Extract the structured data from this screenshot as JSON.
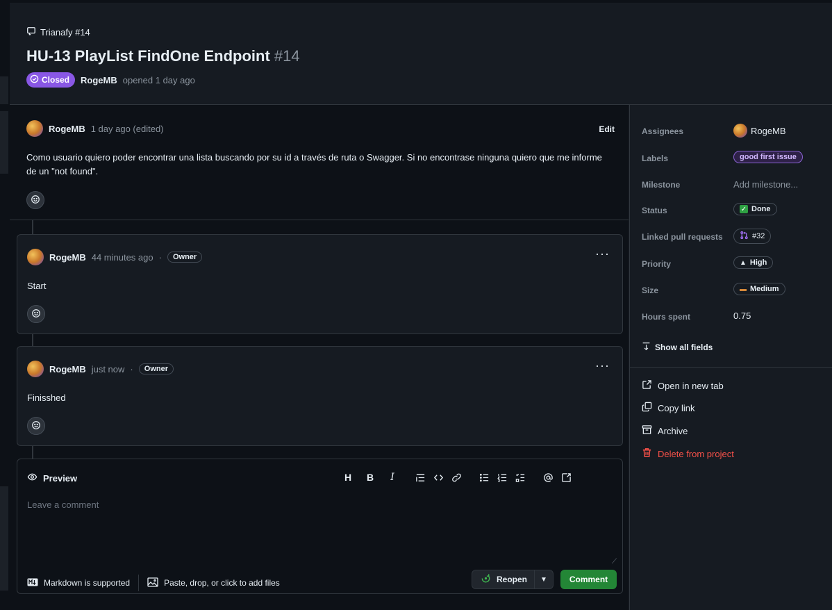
{
  "header": {
    "repo": "Trianafy #14",
    "title": "HU-13 PlayList FindOne Endpoint",
    "number": "#14",
    "state": "Closed",
    "author": "RogeMB",
    "opened_text": "opened 1 day ago"
  },
  "description": {
    "author": "RogeMB",
    "time": "1 day ago (edited)",
    "edit_label": "Edit",
    "body": "Como usuario quiero poder encontrar una lista buscando por su id a través de ruta o Swagger. Si no encontrase ninguna quiero que me informe de un \"not found\"."
  },
  "comments": [
    {
      "author": "RogeMB",
      "time": "44 minutes ago",
      "separator": "·",
      "badge": "Owner",
      "body": "Start",
      "menu": "···"
    },
    {
      "author": "RogeMB",
      "time": "just now",
      "separator": "·",
      "badge": "Owner",
      "body": "Finisshed",
      "menu": "···"
    }
  ],
  "composer": {
    "preview_label": "Preview",
    "toolbar": [
      "H",
      "B",
      "I",
      "quote",
      "code",
      "link",
      "ul",
      "ol",
      "tasks",
      "mention",
      "reference"
    ],
    "placeholder": "Leave a comment",
    "markdown_note": "Markdown is supported",
    "files_note": "Paste, drop, or click to add files",
    "reopen_label": "Reopen",
    "comment_label": "Comment"
  },
  "sidebar": {
    "fields": [
      {
        "label": "Assignees",
        "value": "RogeMB"
      },
      {
        "label": "Labels",
        "value": "good first issue"
      },
      {
        "label": "Milestone",
        "value": "Add milestone..."
      },
      {
        "label": "Status",
        "value": "Done"
      },
      {
        "label": "Linked pull requests",
        "value": "#32"
      },
      {
        "label": "Priority",
        "value": "High"
      },
      {
        "label": "Size",
        "value": "Medium"
      },
      {
        "label": "Hours spent",
        "value": "0.75"
      }
    ],
    "show_all": "Show all fields",
    "actions": {
      "open_tab": "Open in new tab",
      "copy_link": "Copy link",
      "archive": "Archive",
      "delete": "Delete from project"
    }
  },
  "colors": {
    "closed": "#8957e5",
    "comment_button": "#238636",
    "danger": "#f85149",
    "background": "#0d1117"
  }
}
